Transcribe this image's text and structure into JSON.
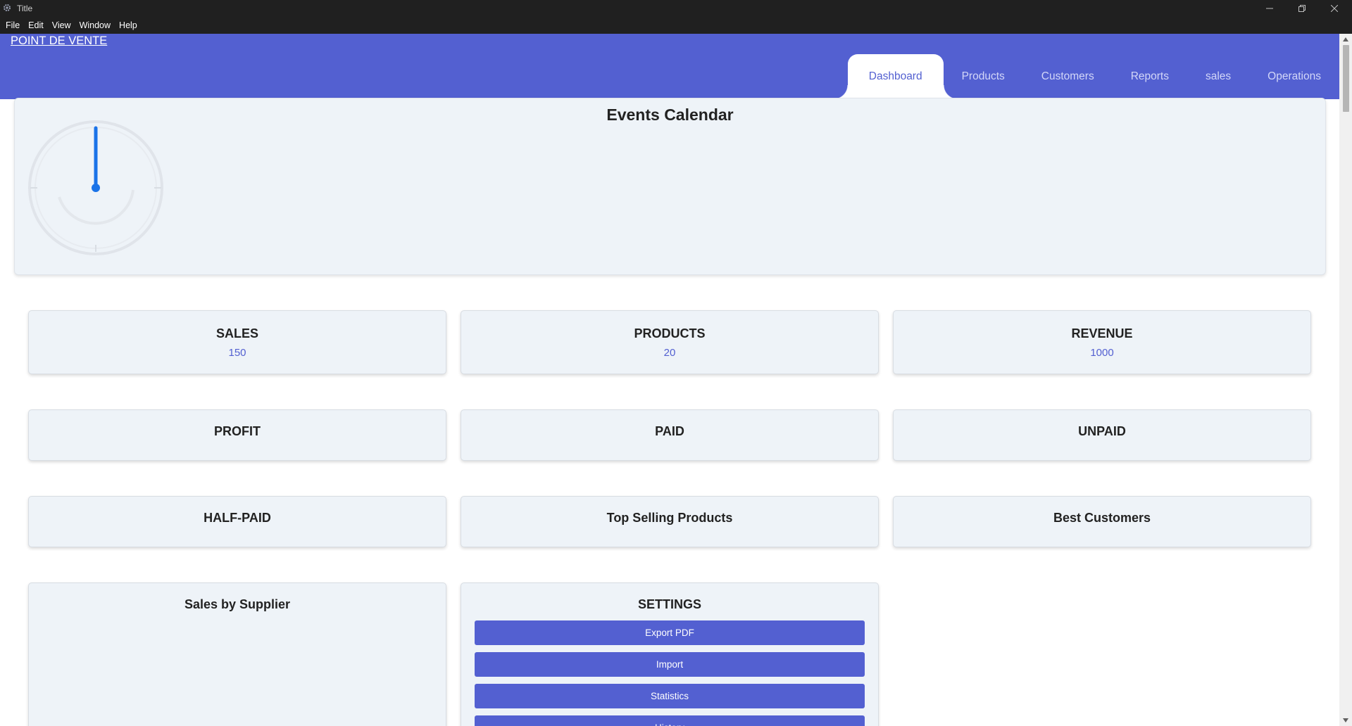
{
  "window": {
    "title": "Title",
    "controls": {
      "minimize": "minimize-icon",
      "maximize": "restore-icon",
      "close": "close-icon"
    }
  },
  "menu": [
    "File",
    "Edit",
    "View",
    "Window",
    "Help"
  ],
  "navbar": {
    "brand": "POINT DE VENTE",
    "tabs": [
      "Dashboard",
      "Products",
      "Customers",
      "Reports",
      "sales",
      "Operations"
    ],
    "active_tab": "Dashboard"
  },
  "events": {
    "title": "Events Calendar"
  },
  "cards": {
    "sales": {
      "label": "SALES",
      "value": "150"
    },
    "products": {
      "label": "PRODUCTS",
      "value": "20"
    },
    "revenue": {
      "label": "REVENUE",
      "value": "1000"
    },
    "profit": {
      "label": "PROFIT"
    },
    "paid": {
      "label": "PAID"
    },
    "unpaid": {
      "label": "UNPAID"
    },
    "half_paid": {
      "label": "HALF-PAID"
    },
    "top_selling": {
      "label": "Top Selling Products"
    },
    "best_customers": {
      "label": "Best Customers"
    },
    "sales_by_supplier": {
      "label": "Sales by Supplier"
    }
  },
  "settings": {
    "title": "SETTINGS",
    "buttons": [
      "Export PDF",
      "Import",
      "Statistics",
      "History"
    ]
  },
  "colors": {
    "accent": "#5360d1",
    "card_bg": "#eef3f8",
    "titlebar_bg": "#202020",
    "clock_hand": "#1a73e8"
  }
}
